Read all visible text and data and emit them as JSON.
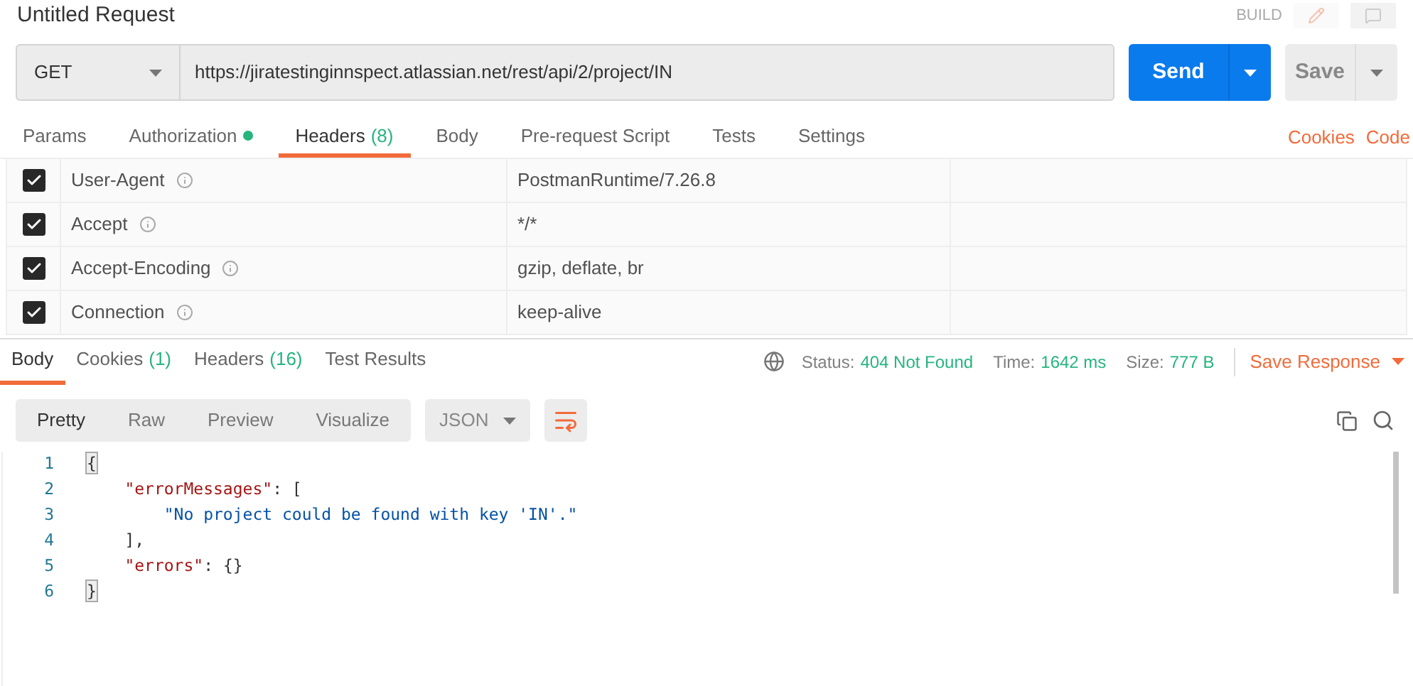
{
  "request": {
    "title": "Untitled Request",
    "mode": "BUILD"
  },
  "url_bar": {
    "method": "GET",
    "url": "https://jiratestinginnspect.atlassian.net/rest/api/2/project/IN",
    "send": "Send",
    "save": "Save"
  },
  "request_tabs": [
    {
      "label": "Params",
      "selected": false
    },
    {
      "label": "Authorization",
      "selected": false,
      "dot": true
    },
    {
      "label": "Headers",
      "count": "(8)",
      "selected": true
    },
    {
      "label": "Body",
      "selected": false
    },
    {
      "label": "Pre-request Script",
      "selected": false
    },
    {
      "label": "Tests",
      "selected": false
    },
    {
      "label": "Settings",
      "selected": false
    }
  ],
  "request_links": [
    "Cookies",
    "Code"
  ],
  "headers": [
    {
      "key": "User-Agent",
      "value": "PostmanRuntime/7.26.8",
      "checked": true
    },
    {
      "key": "Accept",
      "value": "*/*",
      "checked": true
    },
    {
      "key": "Accept-Encoding",
      "value": "gzip, deflate, br",
      "checked": true
    },
    {
      "key": "Connection",
      "value": "keep-alive",
      "checked": true
    }
  ],
  "response_tabs": [
    {
      "label": "Body",
      "selected": true
    },
    {
      "label": "Cookies",
      "count": "(1)",
      "selected": false
    },
    {
      "label": "Headers",
      "count": "(16)",
      "selected": false
    },
    {
      "label": "Test Results",
      "selected": false
    }
  ],
  "response_meta": [
    {
      "label": "Status:",
      "value": "404 Not Found"
    },
    {
      "label": "Time:",
      "value": "1642 ms"
    },
    {
      "label": "Size:",
      "value": "777 B"
    }
  ],
  "save_response": "Save Response",
  "view_modes": [
    {
      "label": "Pretty",
      "selected": true
    },
    {
      "label": "Raw",
      "selected": false
    },
    {
      "label": "Preview",
      "selected": false
    },
    {
      "label": "Visualize",
      "selected": false
    }
  ],
  "format": "JSON",
  "code": [
    {
      "number": "1",
      "tokens": [
        {
          "kind": "brace",
          "text": "{"
        }
      ]
    },
    {
      "number": "2",
      "tokens": [
        {
          "kind": "key",
          "text": "    \"errorMessages\""
        },
        {
          "kind": "punct",
          "text": ": ["
        }
      ]
    },
    {
      "number": "3",
      "tokens": [
        {
          "kind": "string",
          "text": "        \"No project could be found with key 'IN'.\""
        }
      ]
    },
    {
      "number": "4",
      "tokens": [
        {
          "kind": "punct",
          "text": "    ],"
        }
      ]
    },
    {
      "number": "5",
      "tokens": [
        {
          "kind": "key",
          "text": "    \"errors\""
        },
        {
          "kind": "punct",
          "text": ": {}"
        }
      ]
    },
    {
      "number": "6",
      "tokens": [
        {
          "kind": "brace",
          "text": "}"
        }
      ]
    }
  ]
}
